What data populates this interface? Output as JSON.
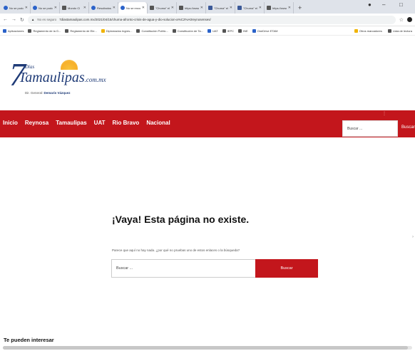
{
  "browser": {
    "tabs": [
      {
        "title": "No se pudo",
        "favicon": "globe-icon"
      },
      {
        "title": "No se pudo",
        "favicon": "globe-icon"
      },
      {
        "title": "Mundo Cl",
        "favicon": "news-icon"
      },
      {
        "title": "Resultados",
        "favicon": "results-icon"
      },
      {
        "title": "No se enco",
        "favicon": "globe-icon",
        "active": true
      },
      {
        "title": "\"Chuma\" el",
        "favicon": "page-icon"
      },
      {
        "title": "https://www",
        "favicon": "page-icon"
      },
      {
        "title": "\"Chuma\" el",
        "favicon": "page-icon"
      },
      {
        "title": "\"Chuma\" el",
        "favicon": "page-icon"
      },
      {
        "title": "https://www",
        "favicon": "page-icon"
      }
    ],
    "new_tab": "+",
    "address": {
      "security": "No es seguro",
      "url": "7diastamaulipas.com.mx/2021/04/15/chuma-afronto-crisis-de-agua-y-dio-solucion-a%C2%A0reynosenses/"
    },
    "bookmarks": [
      "Aplicaciones",
      "Reglamento de la G...",
      "Reglamento de Ele...",
      "Diplomados Ingres...",
      "Constitución Polític...",
      "Constitución de Ta...",
      "UAT",
      "IEPC",
      "INE",
      "OneDrive ETAM"
    ],
    "bookmarks_right": [
      "Otros marcadores",
      "Lista de lectura"
    ]
  },
  "site": {
    "logo": {
      "seven": "7",
      "dias": "Días",
      "name": "Tamaulipas",
      "domain": ".com.mx",
      "director_prefix": "Dir. General:",
      "director_name": "Demaris Vázquez"
    },
    "nav": [
      "Inicio",
      "Reynosa",
      "Tamaulipas",
      "UAT",
      "Rio Bravo",
      "Nacional"
    ],
    "nav_search_placeholder": "Buscar ...",
    "nav_search_button": "Buscar"
  },
  "error_page": {
    "title": "¡Vaya! Esta página no existe.",
    "description": "Parece que aquí no hay nada. ¿por qué no pruebas uno de estos enlaces o la búsqueda?",
    "search_placeholder": "Buscar ...",
    "search_button": "Buscar"
  },
  "related_heading": "Te pueden interesar"
}
